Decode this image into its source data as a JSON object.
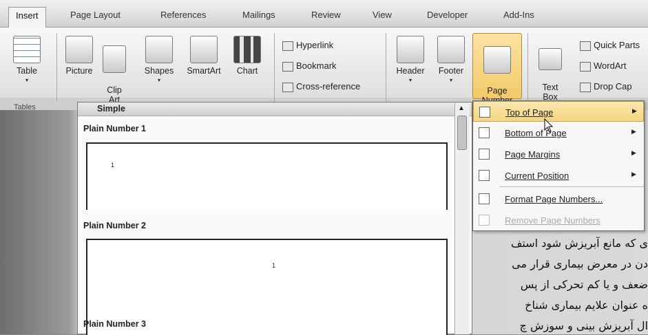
{
  "tabs": [
    "Insert",
    "Page Layout",
    "References",
    "Mailings",
    "Review",
    "View",
    "Developer",
    "Add-Ins"
  ],
  "ribbon": {
    "table": "Table",
    "picture": "Picture",
    "clip_art": "Clip\nArt",
    "shapes": "Shapes",
    "smartart": "SmartArt",
    "chart": "Chart",
    "hyperlink": "Hyperlink",
    "bookmark": "Bookmark",
    "cross_reference": "Cross-reference",
    "header": "Header",
    "footer": "Footer",
    "page_number": "Page\nNumber",
    "text_box": "Text\nBox",
    "quick_parts": "Quick Parts",
    "wordart": "WordArt",
    "drop_cap": "Drop Cap",
    "tables_group": "Tables"
  },
  "gallery": {
    "section": "Simple",
    "items": [
      "Plain Number 1",
      "Plain Number 2",
      "Plain Number 3"
    ],
    "preview_marks": [
      "1",
      "1"
    ]
  },
  "menu": {
    "items": [
      {
        "label": "Top of Page",
        "submenu": true,
        "highlighted": true,
        "disabled": false
      },
      {
        "label": "Bottom of Page",
        "submenu": true,
        "highlighted": false,
        "disabled": false
      },
      {
        "label": "Page Margins",
        "submenu": true,
        "highlighted": false,
        "disabled": false
      },
      {
        "label": "Current Position",
        "submenu": true,
        "highlighted": false,
        "disabled": false
      },
      {
        "label": "Format Page Numbers...",
        "submenu": false,
        "highlighted": false,
        "disabled": false
      },
      {
        "label": "Remove Page Numbers",
        "submenu": false,
        "highlighted": false,
        "disabled": true
      }
    ]
  },
  "document": {
    "lines": [
      "ی که مانع آبریزش شود استف",
      "دن در معرض بیماری قرار می",
      "ضعف و یا کم تحرکی از پس",
      "ه عنوان علایم بیماری شناخ",
      "ال آبریزش بینی و سوزش چ"
    ]
  }
}
